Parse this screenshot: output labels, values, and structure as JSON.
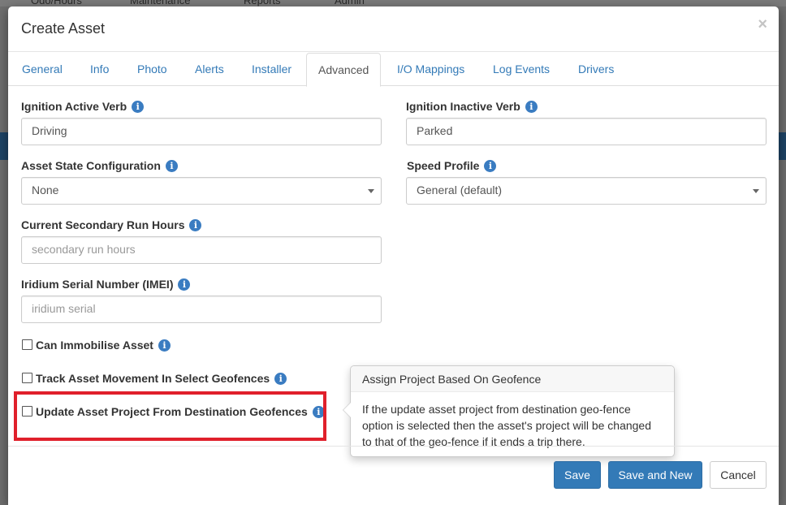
{
  "background": {
    "nav_items": [
      "Odo/Hours",
      "Maintenance",
      "Reports",
      "Admin"
    ]
  },
  "modal": {
    "title": "Create Asset",
    "close_icon": "×"
  },
  "tabs": [
    {
      "label": "General"
    },
    {
      "label": "Info"
    },
    {
      "label": "Photo"
    },
    {
      "label": "Alerts"
    },
    {
      "label": "Installer"
    },
    {
      "label": "Advanced",
      "active": true
    },
    {
      "label": "I/O Mappings"
    },
    {
      "label": "Log Events"
    },
    {
      "label": "Drivers"
    }
  ],
  "form": {
    "ignition_active": {
      "label": "Ignition Active Verb",
      "value": "Driving"
    },
    "ignition_inactive": {
      "label": "Ignition Inactive Verb",
      "value": "Parked"
    },
    "asset_state": {
      "label": "Asset State Configuration",
      "value": "None"
    },
    "speed_profile": {
      "label": "Speed Profile",
      "value": "General (default)"
    },
    "secondary_run_hours": {
      "label": "Current Secondary Run Hours",
      "placeholder": "secondary run hours"
    },
    "iridium_serial": {
      "label": "Iridium Serial Number (IMEI)",
      "placeholder": "iridium serial"
    },
    "can_immobilise": {
      "label": "Can Immobilise Asset",
      "checked": false
    },
    "track_movement": {
      "label": "Track Asset Movement In Select Geofences",
      "checked": false
    },
    "update_project": {
      "label": "Update Asset Project From Destination Geofences",
      "checked": false
    }
  },
  "info_glyph": "i",
  "popover": {
    "title": "Assign Project Based On Geofence",
    "body": "If the update asset project from destination geo-fence option is selected then the asset's project will be changed to that of the geo-fence if it ends a trip there."
  },
  "footer": {
    "save_label": "Save",
    "save_new_label": "Save and New",
    "cancel_label": "Cancel"
  },
  "colors": {
    "primary": "#337ab7",
    "highlight": "#e0202b",
    "info_icon": "#3a7cc1"
  }
}
